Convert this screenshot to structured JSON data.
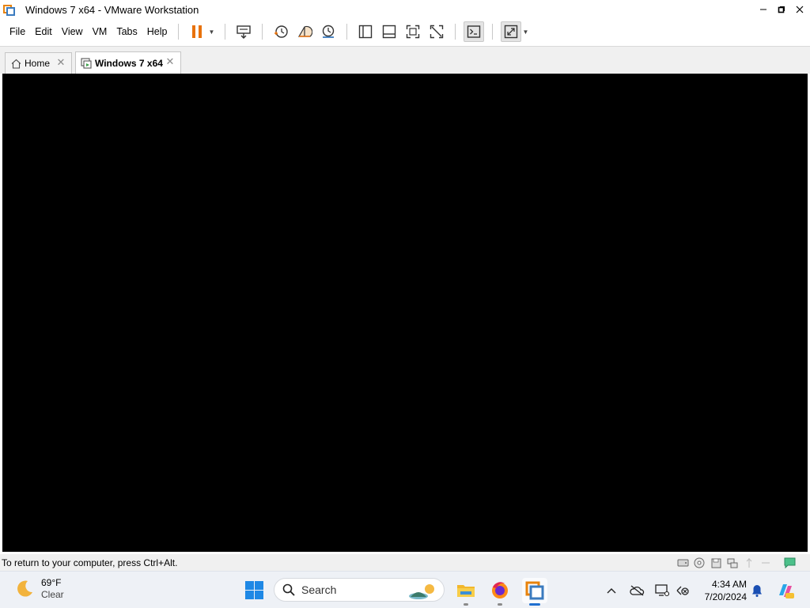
{
  "window": {
    "title": "Windows 7 x64 - VMware Workstation",
    "controls": [
      "minimize-icon",
      "restore-icon",
      "close-icon"
    ]
  },
  "menu": {
    "items": [
      "File",
      "Edit",
      "View",
      "VM",
      "Tabs",
      "Help"
    ]
  },
  "toolbar": {
    "buttons": [
      "pause-icon",
      "send-ctrl-alt-del-icon",
      "snapshot-icon",
      "revert-snapshot-icon",
      "snapshot-manager-icon",
      "show-library-icon",
      "show-thumbnail-bar-icon",
      "full-screen-icon",
      "unity-icon",
      "console-view-icon",
      "stretch-guest-icon"
    ]
  },
  "tabs": [
    {
      "label": "Home",
      "icon": "home-icon",
      "active": false
    },
    {
      "label": "Windows 7 x64",
      "icon": "vm-icon",
      "active": true
    }
  ],
  "status": {
    "message": "To return to your computer, press Ctrl+Alt.",
    "device_icons": [
      "hard-disk-icon",
      "cd-dvd-icon",
      "floppy-icon",
      "network-adapter-icon",
      "usb-icon",
      "sound-icon",
      "message-log-icon"
    ]
  },
  "taskbar": {
    "weather": {
      "temperature": "69°F",
      "condition": "Clear",
      "icon": "moon-icon"
    },
    "search_placeholder": "Search",
    "apps": [
      "start-icon",
      "file-explorer-icon",
      "firefox-icon",
      "vmware-icon"
    ],
    "tray": [
      "chevron-up-icon",
      "onedrive-icon",
      "network-icon",
      "accessibility-icon"
    ],
    "time": "4:34 AM",
    "date": "7/20/2024",
    "extra": [
      "notification-bell-icon",
      "copilot-icon"
    ]
  },
  "colors": {
    "console_bg": "#000000",
    "accent_orange": "#e8830c",
    "accent_blue": "#3b7bbf",
    "taskbar_bg": "#eef1f6"
  }
}
